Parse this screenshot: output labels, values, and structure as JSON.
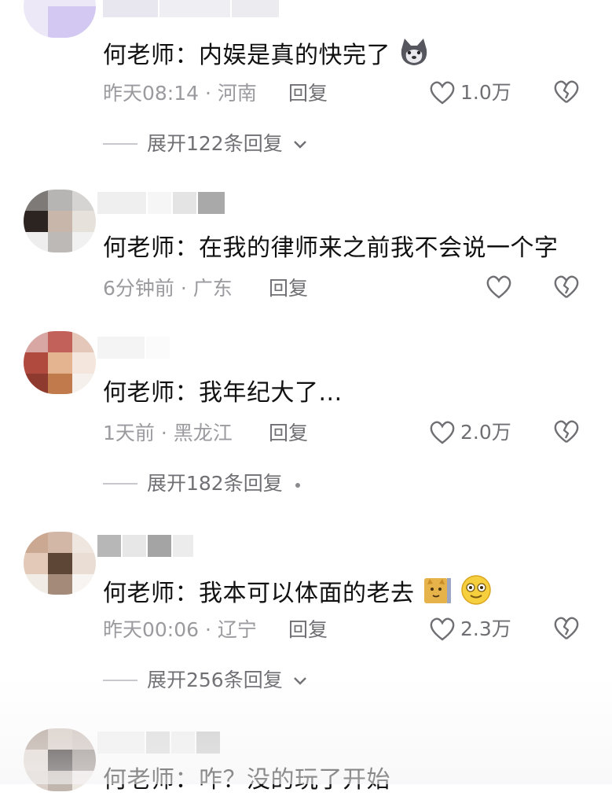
{
  "comments": [
    {
      "text": "何老师：内娱是真的快完了",
      "time": "昨天08:14 · 河南",
      "reply_label": "回复",
      "likes": "1.0万",
      "expand": "展开122条回复",
      "emoji": "husky-emoji"
    },
    {
      "text": "何老师：在我的律师来之前我不会说一个字",
      "time": "6分钟前 · 广东",
      "reply_label": "回复",
      "likes": ""
    },
    {
      "text": "何老师：我年纪大了...",
      "time": "1天前 · 黑龙江",
      "reply_label": "回复",
      "likes": "2.0万",
      "expand": "展开182条回复"
    },
    {
      "text": "何老师：我本可以体面的老去",
      "time": "昨天00:06 · 辽宁",
      "reply_label": "回复",
      "likes": "2.3万",
      "expand": "展开256条回复",
      "emoji": "cat-emoji, smile-emoji"
    },
    {
      "text": "何老师：咋？没的玩了开始"
    }
  ],
  "colors": {
    "text": "#111111",
    "meta": "#9a9a9f",
    "secondary": "#6f6f74"
  }
}
